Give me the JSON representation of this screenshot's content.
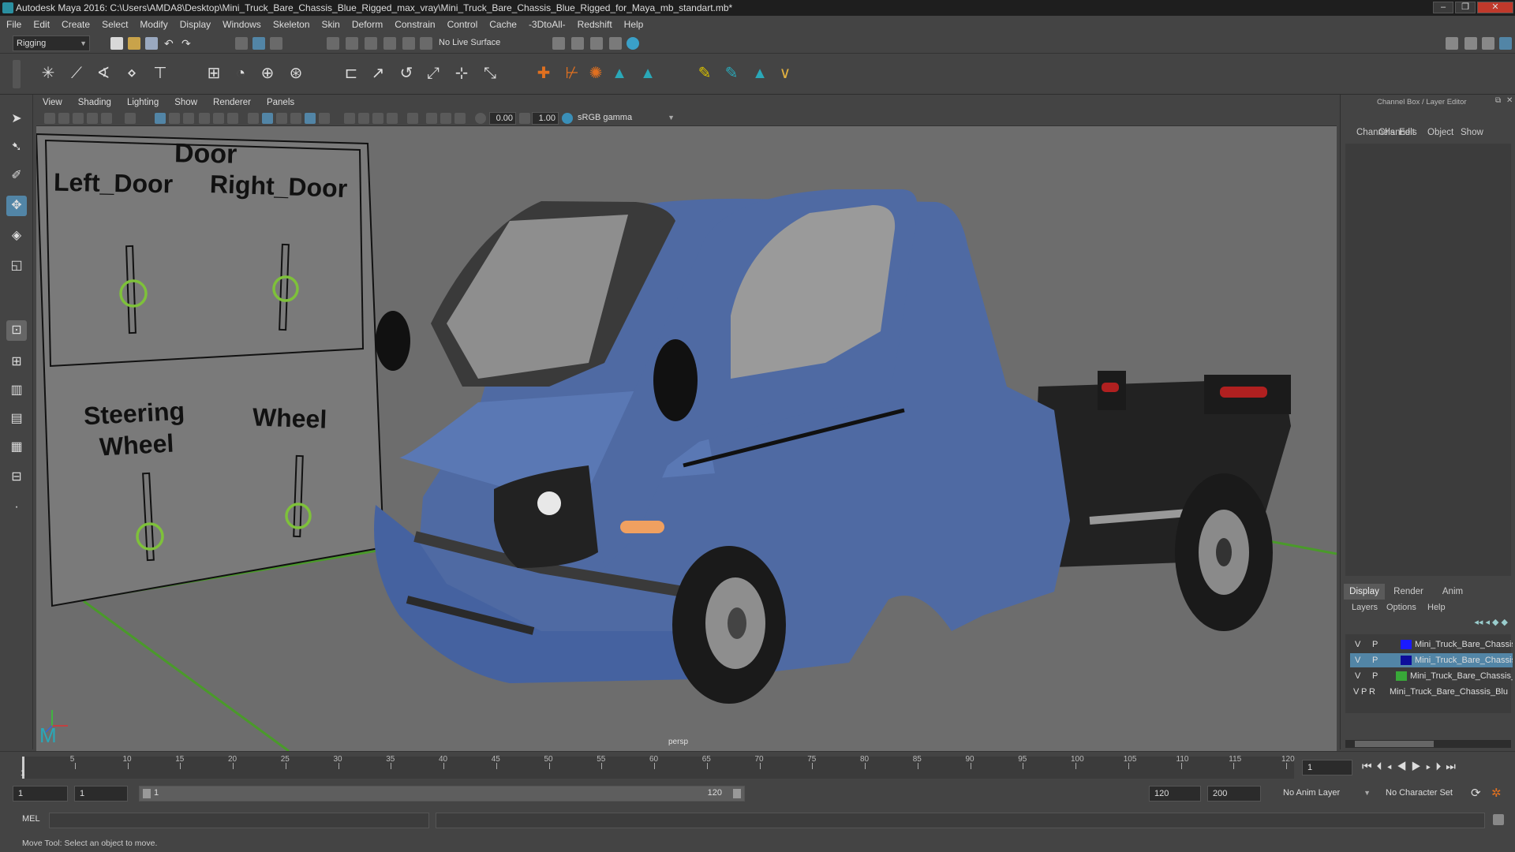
{
  "window": {
    "title": "Autodesk Maya 2016: C:\\Users\\AMDA8\\Desktop\\Mini_Truck_Bare_Chassis_Blue_Rigged_max_vray\\Mini_Truck_Bare_Chassis_Blue_Rigged_for_Maya_mb_standart.mb*",
    "minimize": "–",
    "maximize": "❐",
    "close": "✕"
  },
  "menubar": [
    "File",
    "Edit",
    "Create",
    "Select",
    "Modify",
    "Display",
    "Windows",
    "Skeleton",
    "Skin",
    "Deform",
    "Constrain",
    "Control",
    "Cache",
    "-3DtoAll-",
    "Redshift",
    "Help"
  ],
  "statusline": {
    "mode": "Rigging",
    "live_surface": "No Live Surface"
  },
  "viewport_menu": [
    "View",
    "Shading",
    "Lighting",
    "Show",
    "Renderer",
    "Panels"
  ],
  "viewport_toolbar": {
    "exposure": "0.00",
    "gamma": "1.00",
    "color_space": "sRGB gamma"
  },
  "viewport": {
    "camera_label": "persp",
    "control_board": {
      "door_title": "Door",
      "left_door": "Left_Door",
      "right_door": "Right_Door",
      "steering_line1": "Steering",
      "steering_line2": "Wheel",
      "wheel": "Wheel"
    }
  },
  "right_panel": {
    "header": "Channel Box / Layer Editor",
    "channel_tabs": [
      "Channels",
      "Edit",
      "Object",
      "Show"
    ],
    "layer_tabs": [
      "Display",
      "Render",
      "Anim"
    ],
    "layer_menu": [
      "Layers",
      "Options",
      "Help"
    ],
    "layers": [
      {
        "v": "V",
        "p": "P",
        "r": "",
        "name": "Mini_Truck_Bare_Chassis",
        "color": "#1a1aff"
      },
      {
        "v": "V",
        "p": "P",
        "r": "",
        "name": "Mini_Truck_Bare_Chassis",
        "color": "#0d0d9a"
      },
      {
        "v": "V",
        "p": "P",
        "r": "",
        "name": "Mini_Truck_Bare_Chassis_",
        "color": "#38a838"
      },
      {
        "v": "V",
        "p": "P",
        "r": "R",
        "name": "Mini_Truck_Bare_Chassis_Blu",
        "color": ""
      }
    ]
  },
  "timeline": {
    "ticks": [
      "5",
      "10",
      "15",
      "20",
      "25",
      "30",
      "35",
      "40",
      "45",
      "50",
      "55",
      "60",
      "65",
      "70",
      "75",
      "80",
      "85",
      "90",
      "95",
      "100",
      "105",
      "110",
      "115",
      "120"
    ],
    "current_frame": "1",
    "start_marker": "1"
  },
  "range": {
    "start": "1",
    "playback_start": "1",
    "slider_start": "1",
    "slider_end": "120",
    "playback_end": "120",
    "end": "200",
    "anim_layer": "No Anim Layer",
    "character_set": "No Character Set"
  },
  "command": {
    "label": "MEL"
  },
  "help_line": "Move Tool: Select an object to move.",
  "colors": {
    "accent": "#5285a6",
    "truck_blue": "#4f6aa3",
    "control_green": "#7ec13a",
    "grid_green": "#4a9a2a"
  }
}
